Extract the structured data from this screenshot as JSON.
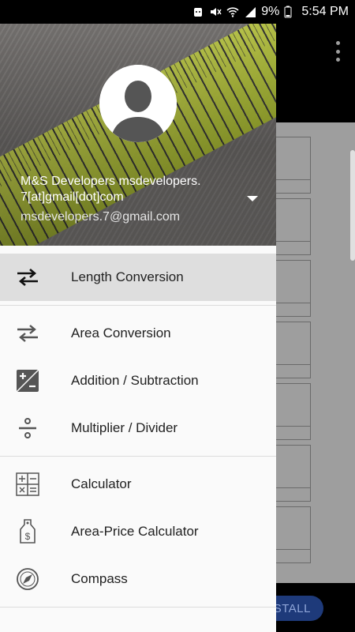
{
  "status_bar": {
    "battery": "9%",
    "time": "5:54 PM"
  },
  "background": {
    "install_label": "INSTALL"
  },
  "drawer": {
    "account": {
      "name": "M&S Developers msdevelopers.\n7[at]gmail[dot]com",
      "email": "msdevelopers.7@gmail.com"
    },
    "group1": [
      {
        "label": "Length Conversion",
        "icon": "swap-arrows-icon",
        "selected": true
      }
    ],
    "group2": [
      {
        "label": "Area Conversion",
        "icon": "swap-arrows-icon"
      },
      {
        "label": "Addition / Subtraction",
        "icon": "plus-minus-icon"
      },
      {
        "label": "Multiplier / Divider",
        "icon": "divide-icon"
      }
    ],
    "group3": [
      {
        "label": "Calculator",
        "icon": "calculator-icon"
      },
      {
        "label": "Area-Price Calculator",
        "icon": "price-tag-icon"
      },
      {
        "label": "Compass",
        "icon": "compass-icon"
      }
    ]
  }
}
